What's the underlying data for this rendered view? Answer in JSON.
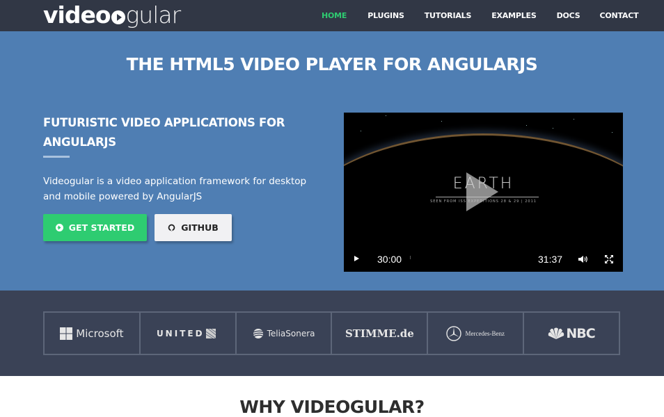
{
  "nav": {
    "logo": {
      "bold": "video",
      "light": "gular",
      "icon": "play-circle-icon"
    },
    "links": [
      {
        "label": "HOME",
        "active": true
      },
      {
        "label": "PLUGINS",
        "active": false
      },
      {
        "label": "TUTORIALS",
        "active": false
      },
      {
        "label": "EXAMPLES",
        "active": false
      },
      {
        "label": "DOCS",
        "active": false
      },
      {
        "label": "CONTACT",
        "active": false
      }
    ]
  },
  "hero": {
    "title": "THE HTML5 VIDEO PLAYER FOR ANGULARJS",
    "subtitle": "FUTURISTIC VIDEO APPLICATIONS FOR ANGULARJS",
    "description": "Videogular is a video application framework for desktop and mobile powered by AngularJS",
    "buttons": {
      "get_started": {
        "label": "GET STARTED",
        "icon": "arrow-circle-right-icon"
      },
      "github": {
        "label": "GITHUB",
        "icon": "github-icon"
      }
    }
  },
  "video": {
    "title": "EARTH",
    "subtitle": "SEEN FROM ISS EXPEDITIONS 28 & 29 | 2011",
    "current_time": "30:00",
    "total_time": "31:37",
    "icons": {
      "play": "play-icon",
      "big_play": "big-play-icon",
      "volume": "volume-icon",
      "fullscreen": "fullscreen-icon"
    }
  },
  "clients": [
    {
      "name": "Microsoft",
      "icon": "microsoft-logo-icon"
    },
    {
      "name": "UNITED",
      "icon": "united-globe-icon"
    },
    {
      "name": "TeliaSonera",
      "icon": "teliasonera-sphere-icon"
    },
    {
      "name": "STIMME.de",
      "icon": ""
    },
    {
      "name": "Mercedes-Benz",
      "icon": "mercedes-star-icon"
    },
    {
      "name": "NBC",
      "icon": "nbc-peacock-icon"
    }
  ],
  "why": {
    "title": "WHY VIDEOGULAR?"
  },
  "colors": {
    "nav_bg": "#313745",
    "hero_bg": "#4f7eb3",
    "accent_green": "#2ecc71",
    "clients_bg": "#3a4256",
    "active_link": "#2ecc71"
  }
}
